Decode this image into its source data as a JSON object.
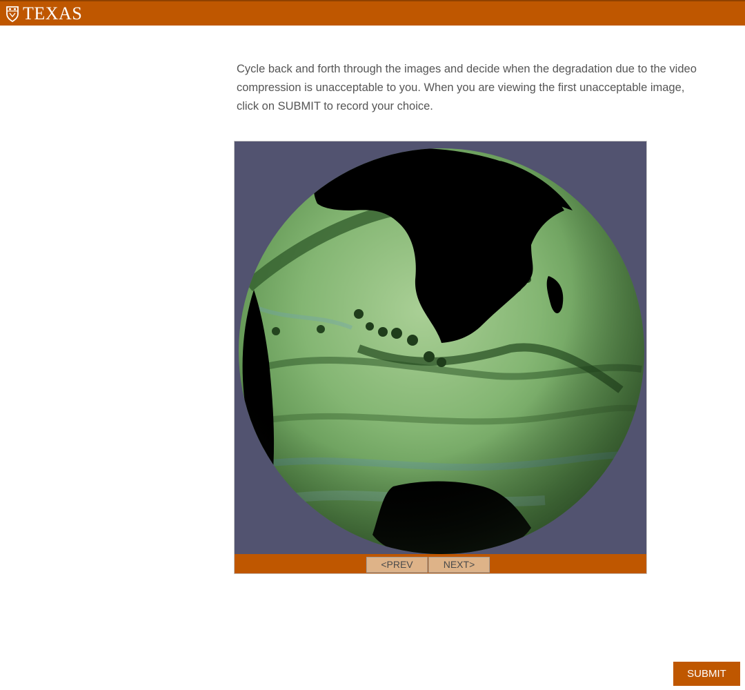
{
  "header": {
    "brand_text": "TEXAS",
    "brand_icon": "shield-icon",
    "bar_color": "#bf5700"
  },
  "main": {
    "instructions": "Cycle back and forth through the images and decide when the degradation due to the video\ncompression is unacceptable to you.  When you are viewing the first unacceptable image,\nclick on SUBMIT to record your choice."
  },
  "viewer": {
    "image_subject": "ocean-globe-visualization",
    "background_color": "#525370",
    "prev_label": "<PREV",
    "next_label": "NEXT>",
    "nav_bar_color": "#bf5700",
    "button_color": "#deb388"
  },
  "footer": {
    "submit_label": "SUBMIT",
    "submit_color": "#bf5700"
  }
}
